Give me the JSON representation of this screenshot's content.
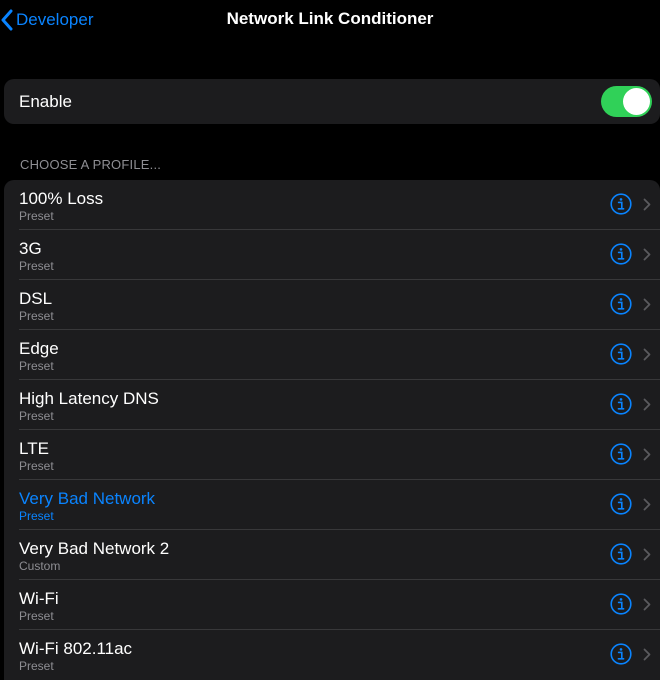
{
  "nav": {
    "back_label": "Developer",
    "title": "Network Link Conditioner"
  },
  "enable": {
    "label": "Enable",
    "on": true
  },
  "section": {
    "header": "CHOOSE A PROFILE..."
  },
  "profiles": [
    {
      "name": "100% Loss",
      "type": "Preset",
      "selected": false
    },
    {
      "name": "3G",
      "type": "Preset",
      "selected": false
    },
    {
      "name": "DSL",
      "type": "Preset",
      "selected": false
    },
    {
      "name": "Edge",
      "type": "Preset",
      "selected": false
    },
    {
      "name": "High Latency DNS",
      "type": "Preset",
      "selected": false
    },
    {
      "name": "LTE",
      "type": "Preset",
      "selected": false
    },
    {
      "name": "Very Bad Network",
      "type": "Preset",
      "selected": true
    },
    {
      "name": "Very Bad Network 2",
      "type": "Custom",
      "selected": false
    },
    {
      "name": "Wi-Fi",
      "type": "Preset",
      "selected": false
    },
    {
      "name": "Wi-Fi 802.11ac",
      "type": "Preset",
      "selected": false
    }
  ],
  "icons": {
    "back": "chevron-left-icon",
    "info": "info-circle-icon",
    "disclosure": "chevron-right-icon"
  },
  "colors": {
    "accent": "#0a84ff",
    "toggle_on": "#30d158",
    "background": "#000000",
    "cell": "#1c1c1e",
    "secondary_text": "#8e8e93"
  }
}
